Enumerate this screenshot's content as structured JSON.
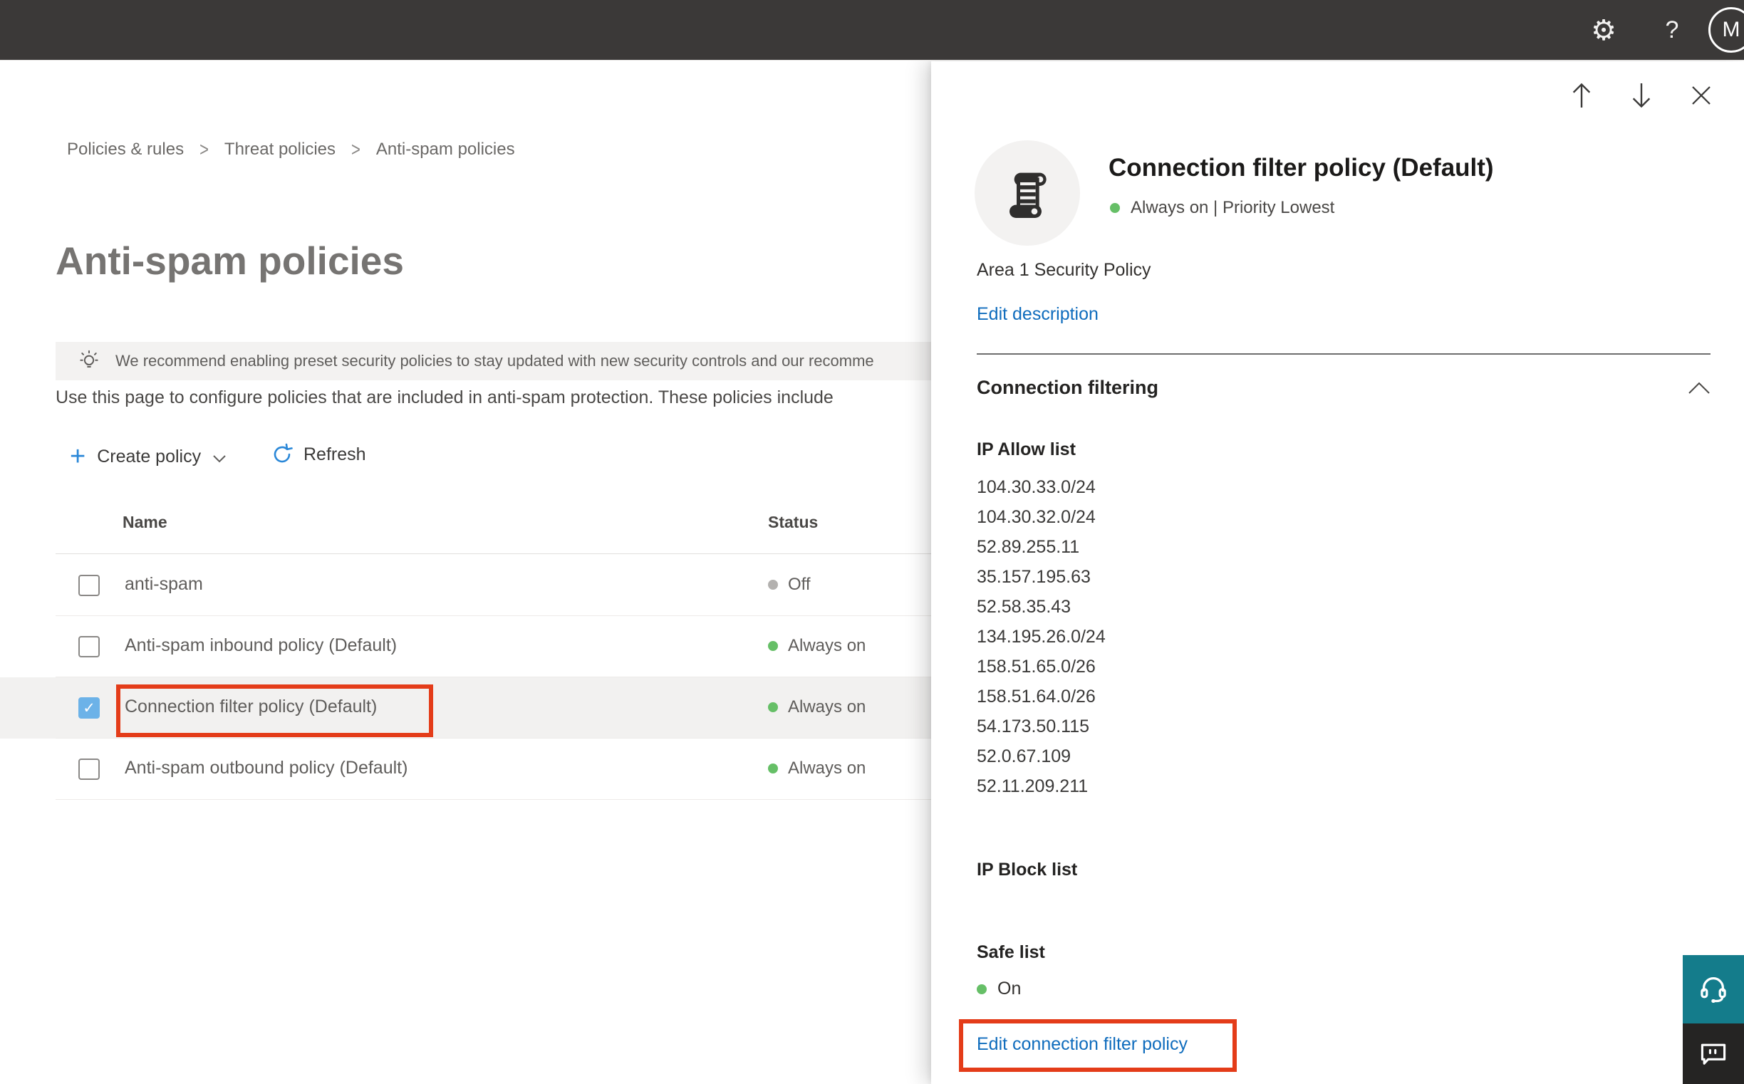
{
  "topbar": {
    "avatar_initial": "M"
  },
  "breadcrumb": {
    "items": [
      "Policies & rules",
      "Threat policies",
      "Anti-spam policies"
    ]
  },
  "page": {
    "title": "Anti-spam policies",
    "banner_text": "We recommend enabling preset security policies to stay updated with new security controls and our recomme",
    "description": "Use this page to configure policies that are included in anti-spam protection. These policies include"
  },
  "toolbar": {
    "create_policy_label": "Create policy",
    "refresh_label": "Refresh"
  },
  "table": {
    "headers": {
      "name": "Name",
      "status": "Status"
    },
    "rows": [
      {
        "name": "anti-spam",
        "status": "Off"
      },
      {
        "name": "Anti-spam inbound policy (Default)",
        "status": "Always on"
      },
      {
        "name": "Connection filter policy (Default)",
        "status": "Always on"
      },
      {
        "name": "Anti-spam outbound policy (Default)",
        "status": "Always on"
      }
    ]
  },
  "panel": {
    "title": "Connection filter policy (Default)",
    "status_line": "Always on | Priority Lowest",
    "description": "Area 1 Security Policy",
    "edit_description_label": "Edit description",
    "section_title": "Connection filtering",
    "ip_allow_title": "IP Allow list",
    "ip_allow_items": [
      "104.30.33.0/24",
      "104.30.32.0/24",
      "52.89.255.11",
      "35.157.195.63",
      "52.58.35.43",
      "134.195.26.0/24",
      "158.51.65.0/26",
      "158.51.64.0/26",
      "54.173.50.115",
      "52.0.67.109",
      "52.11.209.211"
    ],
    "ip_block_title": "IP Block list",
    "safe_list_title": "Safe list",
    "safe_list_status": "On",
    "edit_link_label": "Edit connection filter policy"
  },
  "colors": {
    "accent_link": "#0f6cbd",
    "status_on_green": "#66bf67",
    "status_off_gray": "#b3b1af",
    "annotation_red": "#e43c19",
    "checked_checkbox_blue": "#6cb2e8",
    "support_teal": "#147c8b",
    "topbar_dark": "#3b3938"
  }
}
